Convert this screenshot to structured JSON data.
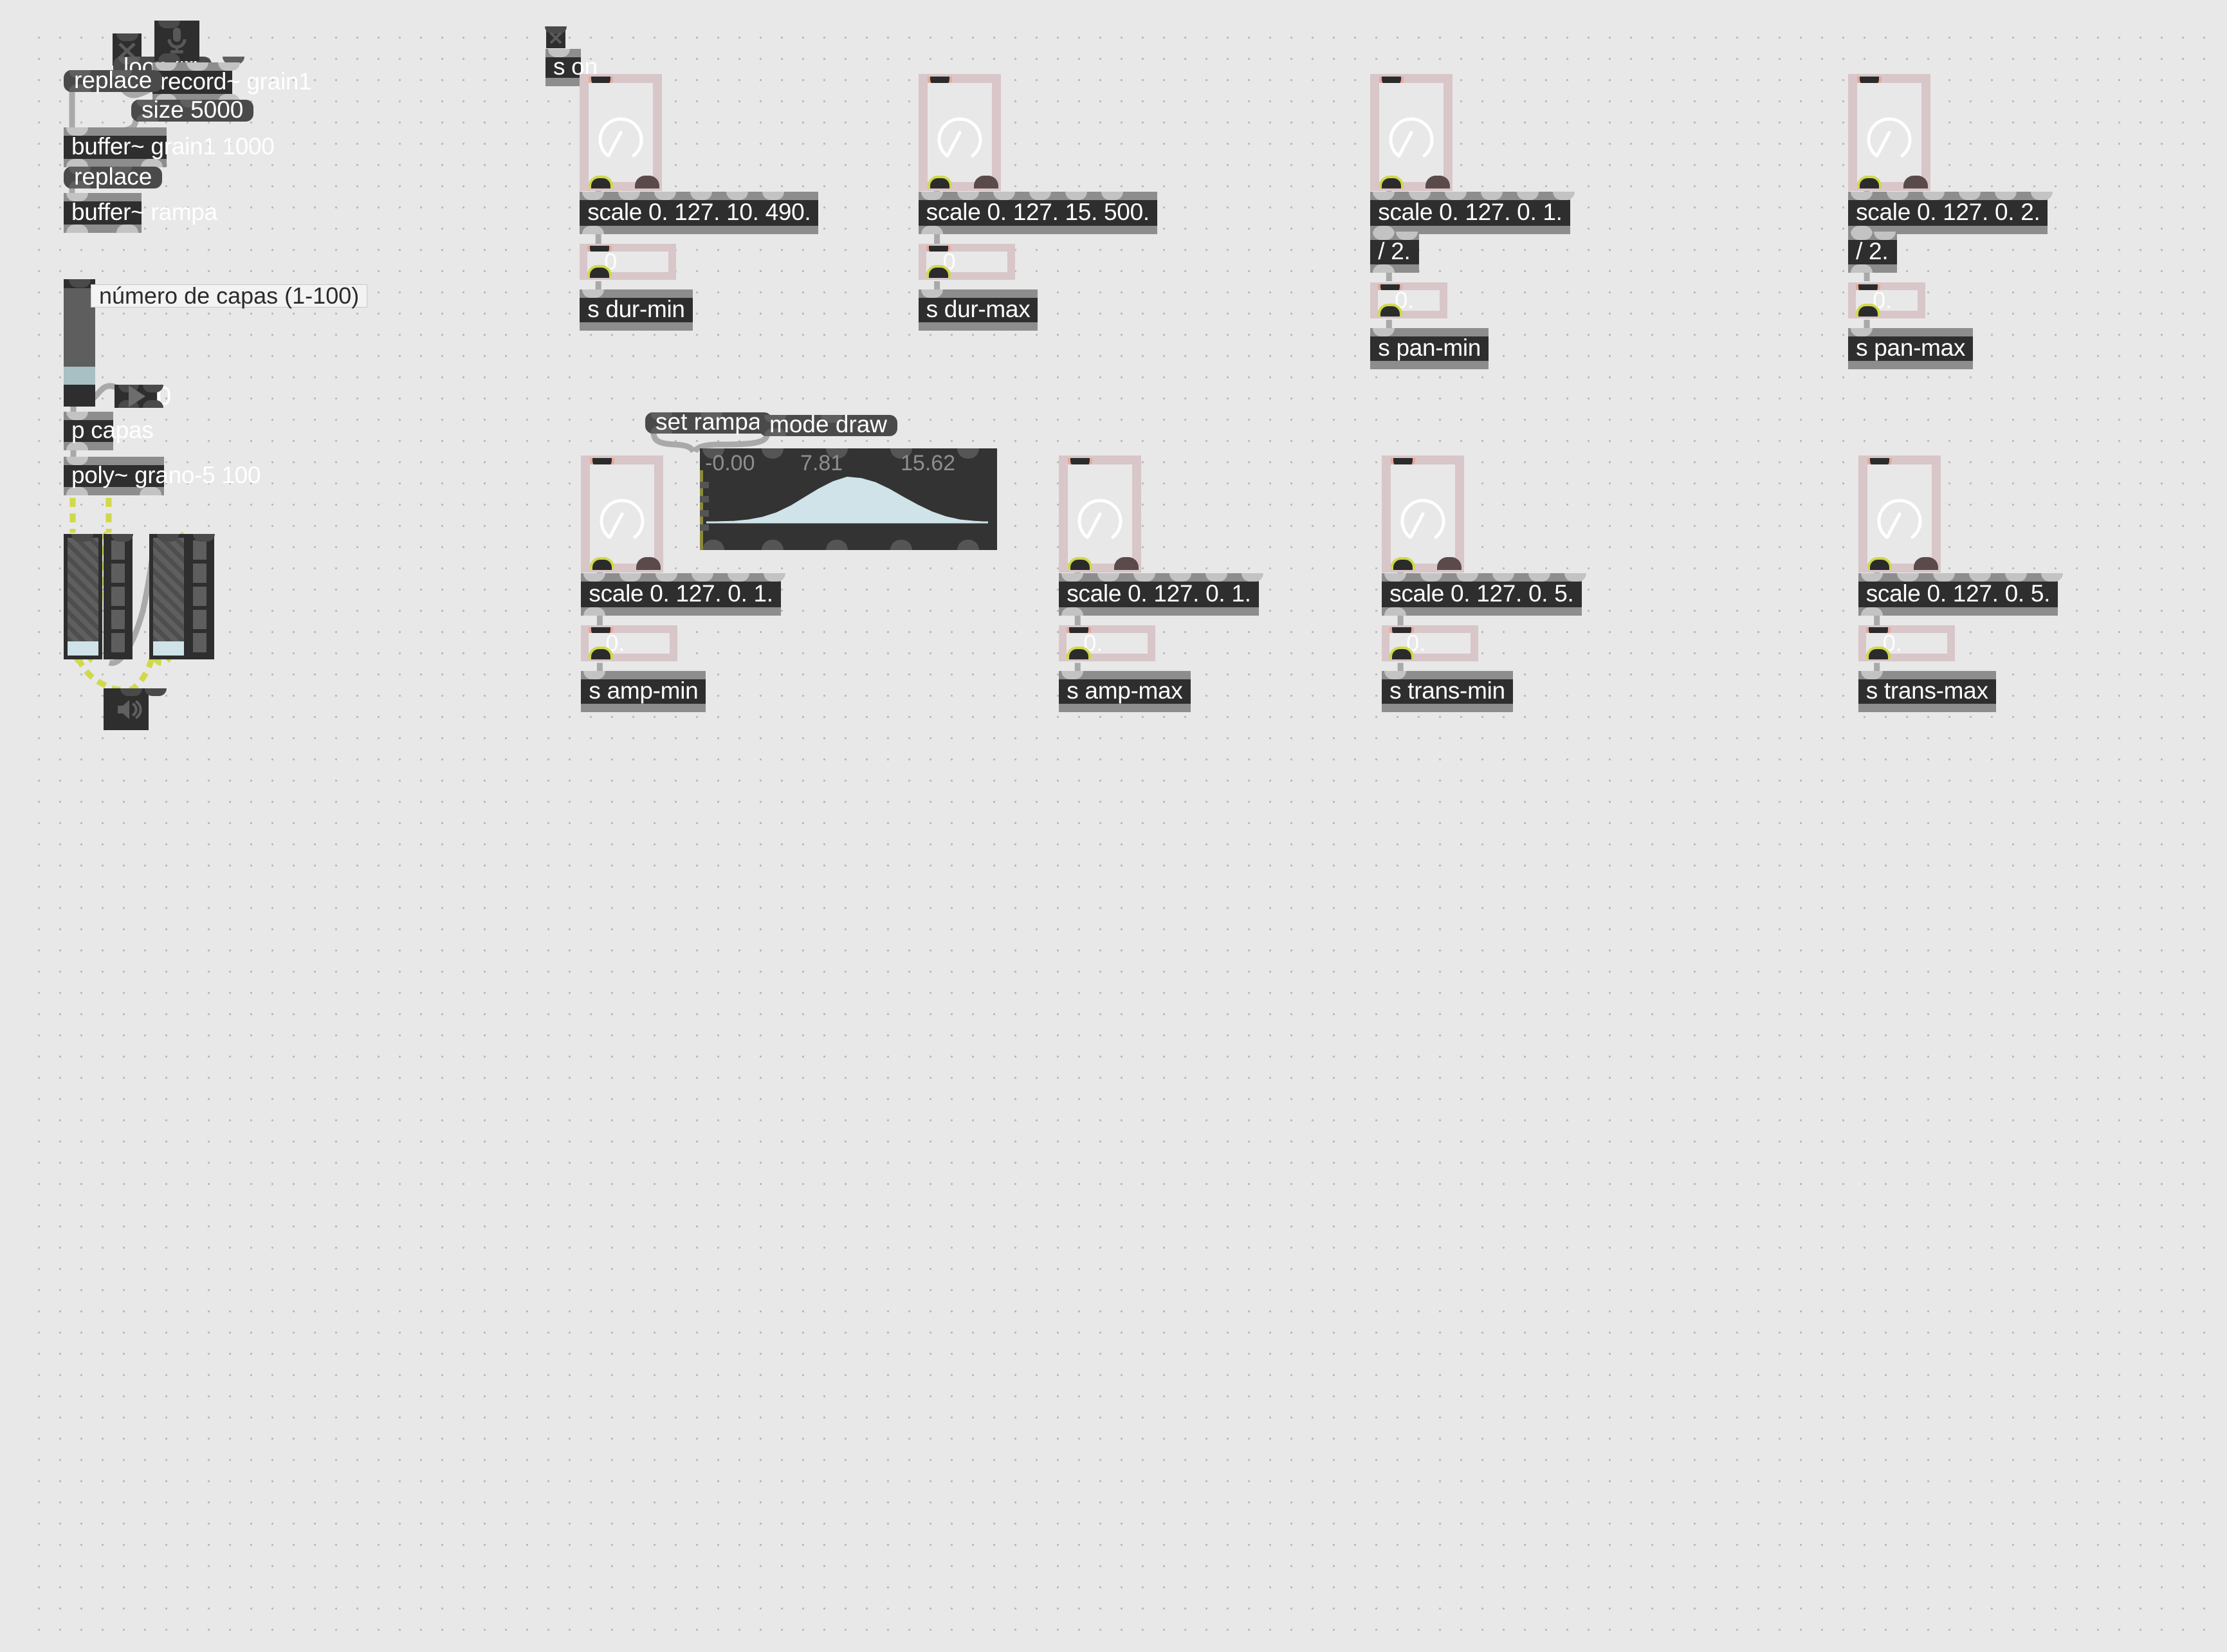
{
  "canvas": {
    "background": "#e8e8e8",
    "grid_dot_color": "#b9b9b9",
    "accent_pink": "#d8c6c9",
    "accent_signal_green": "#cfd94a",
    "accent_inlet_red": "#e8a898",
    "wave_fill": "#cfe3e8"
  },
  "record_section": {
    "toggle_record_name": "record-toggle",
    "loop_message": "loop $1",
    "mic_button": "microphone-button",
    "record_object": "record~ grain1",
    "size_message": "size 5000",
    "replace_grain_message": "replace",
    "buffer_grain": "buffer~ grain1 1000",
    "replace_rampa_message": "replace",
    "buffer_rampa": "buffer~ rampa"
  },
  "capas_section": {
    "comment": "número de capas (1-100)",
    "slider_value": 0,
    "number_display": "0",
    "subpatch": "p capas",
    "poly": "poly~ grano-5 100",
    "dac": "speaker-dac-button"
  },
  "on_section": {
    "toggle_name": "on-toggle",
    "send_on": "s on"
  },
  "params": [
    {
      "id": "dur-min",
      "dial_value": 0,
      "scale": "scale 0. 127. 10. 490.",
      "divide": null,
      "number": "0",
      "send": "s dur-min"
    },
    {
      "id": "dur-max",
      "dial_value": 0,
      "scale": "scale 0. 127. 15. 500.",
      "divide": null,
      "number": "0",
      "send": "s dur-max"
    },
    {
      "id": "pan-min",
      "dial_value": 0,
      "scale": "scale 0. 127. 0. 1.",
      "divide": "/ 2.",
      "number": "0.",
      "send": "s pan-min"
    },
    {
      "id": "pan-max",
      "dial_value": 0,
      "scale": "scale 0. 127. 0. 2.",
      "divide": "/ 2.",
      "number": "0.",
      "send": "s pan-max"
    },
    {
      "id": "amp-min",
      "dial_value": 0,
      "scale": "scale 0. 127. 0. 1.",
      "divide": null,
      "number": "0.",
      "send": "s amp-min"
    },
    {
      "id": "amp-max",
      "dial_value": 0,
      "scale": "scale 0. 127. 0. 1.",
      "divide": null,
      "number": "0.",
      "send": "s amp-max"
    },
    {
      "id": "trans-min",
      "dial_value": 0,
      "scale": "scale 0. 127. 0. 5.",
      "divide": null,
      "number": "0.",
      "send": "s trans-min"
    },
    {
      "id": "trans-max",
      "dial_value": 0,
      "scale": "scale 0. 127. 0. 5.",
      "divide": null,
      "number": "0.",
      "send": "s trans-max"
    }
  ],
  "rampa_section": {
    "set_message": "set rampa",
    "mode_message": "mode draw",
    "axis_labels": [
      "-0.00",
      "7.81",
      "15.62"
    ],
    "waveform_shape": "gaussian-bell"
  },
  "chart_data": {
    "type": "area",
    "title": "",
    "xlabel": "",
    "ylabel": "",
    "x_tick_labels": [
      "-0.00",
      "7.81",
      "15.62"
    ],
    "x": [
      0,
      1,
      2,
      3,
      4,
      5,
      6,
      7,
      8,
      9,
      10,
      11,
      12,
      13,
      14,
      15,
      16,
      17,
      18,
      19,
      20
    ],
    "values": [
      0.0,
      0.01,
      0.02,
      0.05,
      0.11,
      0.21,
      0.36,
      0.55,
      0.74,
      0.9,
      1.0,
      0.97,
      0.88,
      0.73,
      0.55,
      0.38,
      0.23,
      0.12,
      0.05,
      0.02,
      0.0
    ],
    "ylim": [
      0,
      1
    ],
    "grid": false,
    "legend": false
  }
}
